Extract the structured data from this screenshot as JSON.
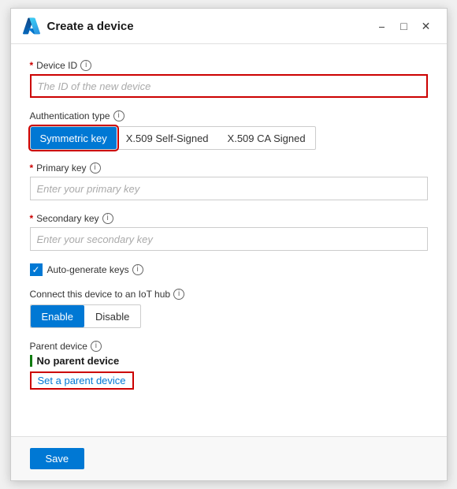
{
  "dialog": {
    "title": "Create a device"
  },
  "header": {
    "minimize_label": "minimize",
    "restore_label": "restore",
    "close_label": "close"
  },
  "form": {
    "device_id": {
      "label": "Device ID",
      "required": true,
      "placeholder": "The ID of the new device",
      "value": ""
    },
    "authentication_type": {
      "label": "Authentication type",
      "options": [
        {
          "id": "symmetric",
          "label": "Symmetric key",
          "active": true
        },
        {
          "id": "x509-self",
          "label": "X.509 Self-Signed",
          "active": false
        },
        {
          "id": "x509-ca",
          "label": "X.509 CA Signed",
          "active": false
        }
      ]
    },
    "primary_key": {
      "label": "Primary key",
      "required": true,
      "placeholder": "Enter your primary key",
      "value": ""
    },
    "secondary_key": {
      "label": "Secondary key",
      "required": true,
      "placeholder": "Enter your secondary key",
      "value": ""
    },
    "auto_generate_keys": {
      "label": "Auto-generate keys",
      "checked": true
    },
    "connect_to_hub": {
      "label": "Connect this device to an IoT hub",
      "options": [
        {
          "id": "enable",
          "label": "Enable",
          "active": true
        },
        {
          "id": "disable",
          "label": "Disable",
          "active": false
        }
      ]
    },
    "parent_device": {
      "label": "Parent device",
      "no_parent_text": "No parent device",
      "set_parent_label": "Set a parent device"
    }
  },
  "footer": {
    "save_label": "Save"
  }
}
